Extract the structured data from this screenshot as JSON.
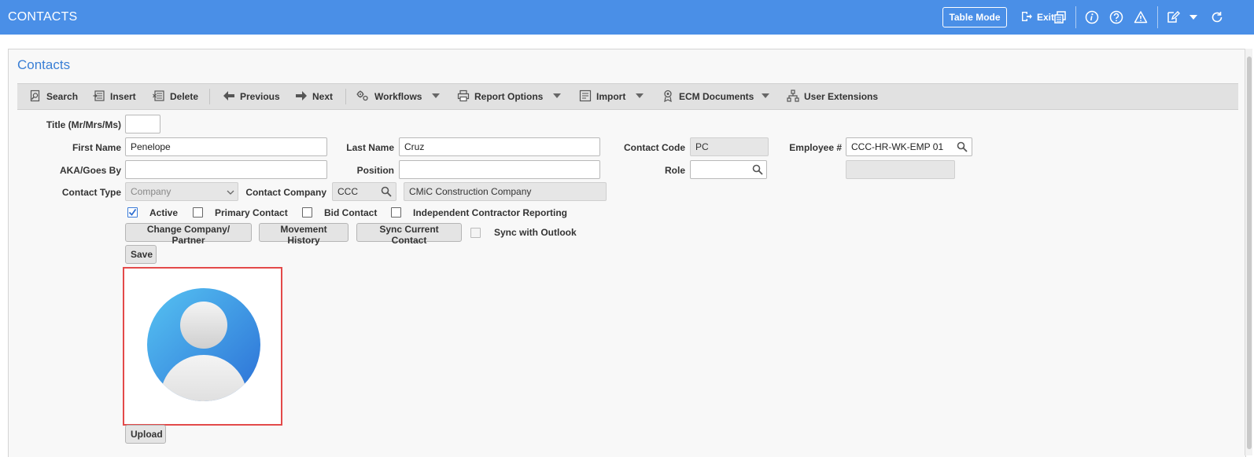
{
  "header": {
    "title": "CONTACTS",
    "table_mode_label": "Table Mode",
    "exit_label": "Exit",
    "icons": [
      "exit-icon",
      "print-icon",
      "info-icon",
      "help-icon",
      "warning-icon",
      "edit-icon",
      "dropdown-icon",
      "refresh-icon"
    ]
  },
  "page": {
    "title": "Contacts"
  },
  "toolbar": {
    "search": "Search",
    "insert": "Insert",
    "delete": "Delete",
    "previous": "Previous",
    "next": "Next",
    "workflows": "Workflows",
    "report_options": "Report Options",
    "import": "Import",
    "ecm_documents": "ECM Documents",
    "user_extensions": "User Extensions"
  },
  "form": {
    "title_label": "Title (Mr/Mrs/Ms)",
    "title_value": "",
    "first_name_label": "First Name",
    "first_name_value": "Penelope",
    "last_name_label": "Last Name",
    "last_name_value": "Cruz",
    "contact_code_label": "Contact Code",
    "contact_code_value": "PC",
    "employee_label": "Employee #",
    "employee_value": "CCC-HR-WK-EMP 01",
    "aka_label": "AKA/Goes By",
    "aka_value": "",
    "position_label": "Position",
    "position_value": "",
    "role_label": "Role",
    "role_value": "",
    "employee_name_value": "",
    "contact_type_label": "Contact Type",
    "contact_type_value": "Company",
    "contact_company_label": "Contact Company",
    "contact_company_code": "CCC",
    "contact_company_name": "CMiC Construction Company"
  },
  "checkboxes": {
    "active": {
      "label": "Active",
      "checked": true
    },
    "primary_contact": {
      "label": "Primary Contact",
      "checked": false
    },
    "bid_contact": {
      "label": "Bid Contact",
      "checked": false
    },
    "independent_contractor": {
      "label": "Independent Contractor Reporting",
      "checked": false
    },
    "sync_with_outlook": {
      "label": "Sync with Outlook",
      "checked": false
    }
  },
  "buttons": {
    "change_company": "Change Company/ Partner",
    "movement_history": "Movement History",
    "sync_current_contact": "Sync Current Contact",
    "save": "Save",
    "upload": "Upload"
  },
  "colors": {
    "header_bg": "#4a8fe7",
    "accent": "#3a7fd5",
    "highlight_border": "#e34a4a"
  }
}
